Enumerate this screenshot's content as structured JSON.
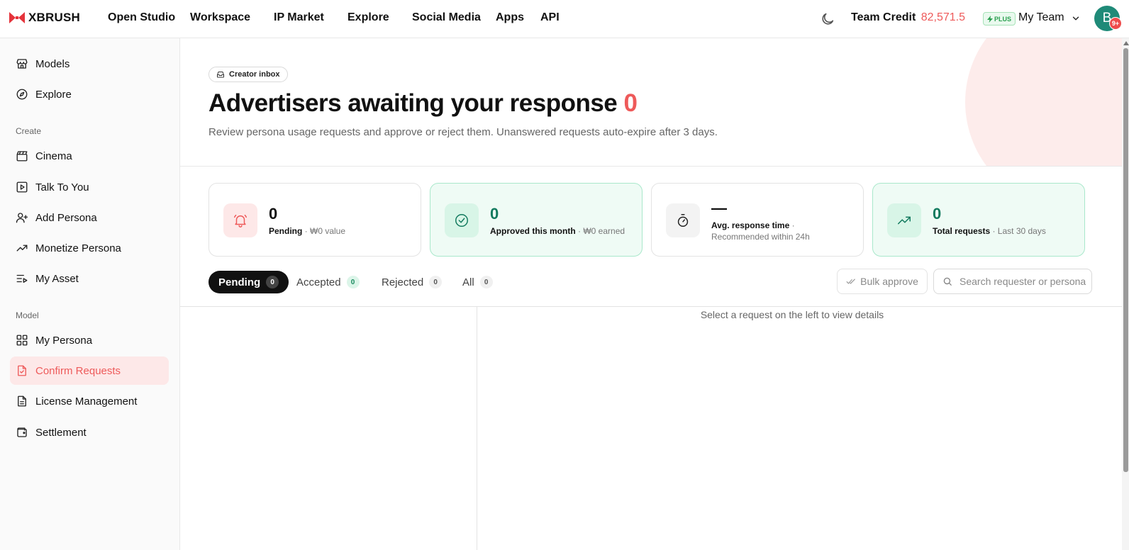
{
  "brand": {
    "name": "XBRUSH",
    "logo_icon": "xbrush-logo-icon",
    "accent": "#e5333b"
  },
  "nav": [
    {
      "label": "Open Studio"
    },
    {
      "label": "Workspace"
    },
    {
      "label": "IP Market"
    },
    {
      "label": "Explore"
    },
    {
      "label": "Social Media"
    },
    {
      "label": "Apps"
    },
    {
      "label": "API"
    }
  ],
  "header": {
    "theme_icon": "moon-icon",
    "credit_label": "Team Credit",
    "credit_value": "82,571.5",
    "plan_badge": "PLUS",
    "team_name": "My Team",
    "avatar_initial": "B",
    "notification_count": "9+"
  },
  "sidebar": {
    "top_items": [
      {
        "label": "Models",
        "icon": "store-icon"
      },
      {
        "label": "Explore",
        "icon": "compass-icon"
      }
    ],
    "sections": [
      {
        "title": "Create",
        "items": [
          {
            "label": "Cinema",
            "icon": "clapperboard-icon"
          },
          {
            "label": "Talk To You",
            "icon": "play-square-icon"
          },
          {
            "label": "Add Persona",
            "icon": "user-plus-icon"
          },
          {
            "label": "Monetize Persona",
            "icon": "trending-up-icon"
          },
          {
            "label": "My Asset",
            "icon": "list-video-icon"
          }
        ]
      },
      {
        "title": "Model",
        "items": [
          {
            "label": "My Persona",
            "icon": "grid-icon"
          },
          {
            "label": "Confirm Requests",
            "icon": "file-check-icon",
            "active": true
          },
          {
            "label": "License Management",
            "icon": "file-text-icon"
          },
          {
            "label": "Settlement",
            "icon": "wallet-icon"
          }
        ]
      }
    ]
  },
  "hero": {
    "chip_label": "Creator inbox",
    "chip_icon": "inbox-icon",
    "title": "Advertisers awaiting your response",
    "count": "0",
    "subtitle": "Review persona usage requests and approve or reject them. Unanswered requests auto-expire after 3 days."
  },
  "stats": [
    {
      "value": "0",
      "label": "Pending",
      "detail": " · ₩0 value",
      "icon": "bell-ring-icon",
      "tone": "red"
    },
    {
      "value": "0",
      "label": "Approved this month",
      "detail": " · ₩0 earned",
      "icon": "check-circle-icon",
      "tone": "green"
    },
    {
      "value": "—",
      "label": "Avg. response time",
      "detail": " · ",
      "detail2": "Recommended within 24h",
      "icon": "timer-icon",
      "tone": "gray"
    },
    {
      "value": "0",
      "label": "Total requests",
      "detail": " · Last 30 days",
      "icon": "trending-up-icon",
      "tone": "green"
    }
  ],
  "tabs": [
    {
      "label": "Pending",
      "count": "0",
      "active": true
    },
    {
      "label": "Accepted",
      "count": "0"
    },
    {
      "label": "Rejected",
      "count": "0"
    },
    {
      "label": "All",
      "count": "0"
    }
  ],
  "toolbar": {
    "bulk_label": "Bulk approve",
    "search_placeholder": "Search requester or persona",
    "search_value": ""
  },
  "detail": {
    "empty_text": "Select a request on the left to view details"
  },
  "colors": {
    "accent_red": "#ee5a5a",
    "teal": "#127a5e",
    "active_bg": "#fde8e8",
    "green_card": "#effbf5"
  }
}
